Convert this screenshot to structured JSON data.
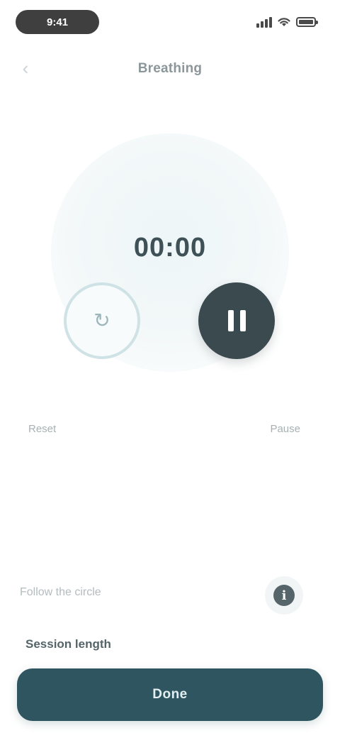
{
  "status_bar": {
    "time": "9:41"
  },
  "header": {
    "title": "Breathing"
  },
  "timer": {
    "value": "00:00"
  },
  "controls": {
    "left_caption": "Reset",
    "right_caption": "Pause"
  },
  "bottom": {
    "hint": "Follow the circle",
    "session_label": "Session length",
    "primary_label": "Done"
  },
  "colors": {
    "accent": "#2e5560",
    "dark_button": "#3b4a4f",
    "ring": "#cfe2e5"
  },
  "icons": {
    "back": "chevron-left-icon",
    "reset": "refresh-icon",
    "pause": "pause-icon",
    "info": "info-icon"
  }
}
